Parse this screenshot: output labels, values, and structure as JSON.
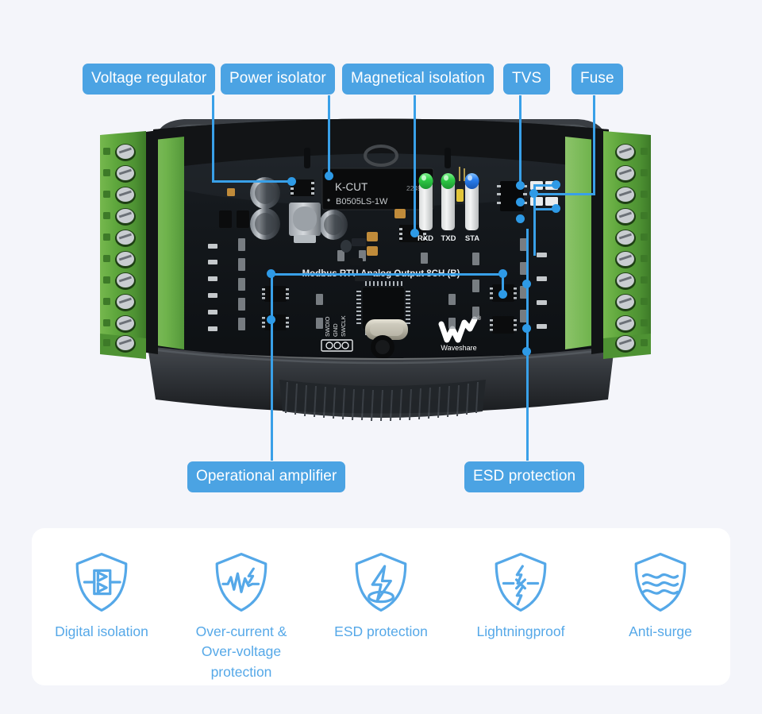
{
  "background_color": "#f4f5fa",
  "accent_color": "#4ba3e3",
  "line_color": "#39a0e8",
  "product": {
    "silkscreen_title": "Modbus RTU Analog Output 8CH (B)",
    "brand": "Waveshare",
    "isolator_module": {
      "brand": "K-CUT",
      "date_code": "2249",
      "part_number": "B0505LS-1W"
    },
    "led_labels": [
      "RXD",
      "TXD",
      "STA"
    ],
    "led_colors": [
      "#3ad24f",
      "#3ad24f",
      "#2a7ff0"
    ],
    "debug_header_labels": [
      "SWDIO",
      "GND",
      "SWCLK"
    ],
    "terminal_block_left_pins": 10,
    "terminal_block_right_pins": 10
  },
  "callouts": [
    {
      "id": "voltage-regulator",
      "label": "Voltage regulator"
    },
    {
      "id": "power-isolator",
      "label": "Power isolator"
    },
    {
      "id": "magnetical-isolation",
      "label": "Magnetical isolation"
    },
    {
      "id": "tvs",
      "label": "TVS"
    },
    {
      "id": "fuse",
      "label": "Fuse"
    },
    {
      "id": "operational-amplifier",
      "label": "Operational amplifier"
    },
    {
      "id": "esd-protection",
      "label": "ESD protection"
    }
  ],
  "features": [
    {
      "id": "digital-isolation",
      "icon": "shield-digital-isolation-icon",
      "label": "Digital isolation"
    },
    {
      "id": "over-current-over-voltage",
      "icon": "shield-waveform-icon",
      "label": "Over-current &\nOver-voltage protection"
    },
    {
      "id": "esd-protection",
      "icon": "shield-esd-bolt-icon",
      "label": "ESD protection"
    },
    {
      "id": "lightningproof",
      "icon": "shield-lightning-block-icon",
      "label": "Lightningproof"
    },
    {
      "id": "anti-surge",
      "icon": "shield-waves-icon",
      "label": "Anti-surge"
    }
  ]
}
